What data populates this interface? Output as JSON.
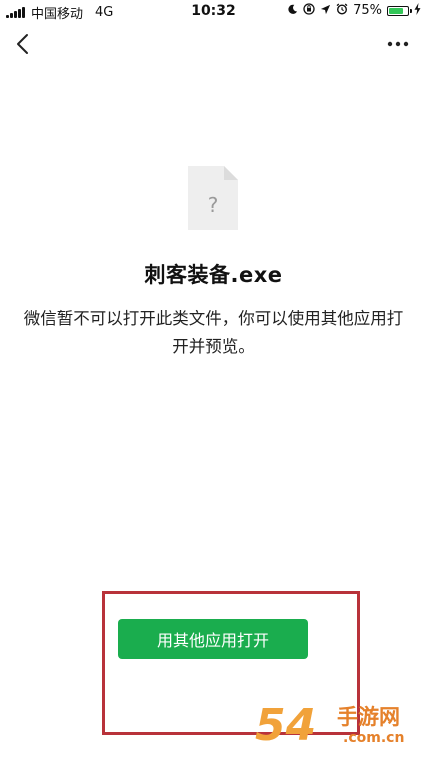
{
  "status_bar": {
    "carrier": "中国移动",
    "network": "4G",
    "time": "10:32",
    "battery_percent": "75%",
    "battery_level": 0.75,
    "icons": [
      "moon-icon",
      "orientation-lock-icon",
      "location-icon",
      "alarm-icon",
      "battery-icon",
      "charging-icon"
    ]
  },
  "nav": {
    "back_icon": "chevron-left-icon",
    "more_icon": "more-dots-icon"
  },
  "file": {
    "icon": "unknown-file-icon",
    "icon_glyph": "?",
    "name": "刺客装备.exe",
    "message": "微信暂不可以打开此类文件，你可以使用其他应用打开并预览。"
  },
  "actions": {
    "open_with_other_app": "用其他应用打开"
  },
  "watermark": {
    "digits": "54",
    "brand": "手游网",
    "url": ".com.cn"
  },
  "colors": {
    "primary_button": "#1aad4e",
    "highlight_border": "#b8323a",
    "battery_fill": "#34c759",
    "watermark": "#e5812b"
  }
}
